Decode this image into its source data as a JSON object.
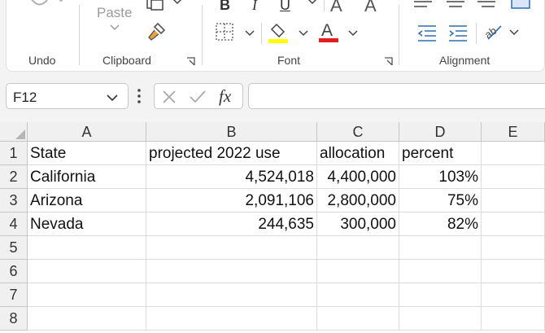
{
  "ribbon": {
    "groups": {
      "undo": "Undo",
      "clipboard": "Clipboard",
      "font": "Font",
      "alignment": "Alignment"
    },
    "paste_label": "Paste",
    "font_color": "#e02020",
    "highlight_color": "#ffff00"
  },
  "formula_bar": {
    "name_box": "F12",
    "formula": ""
  },
  "sheet": {
    "columns": [
      "A",
      "B",
      "C",
      "D",
      "E"
    ],
    "rows": [
      "1",
      "2",
      "3",
      "4",
      "5",
      "6",
      "7",
      "8"
    ],
    "cells": [
      [
        "State",
        "projected 2022 use",
        "allocation",
        "percent",
        ""
      ],
      [
        "California",
        "4,524,018",
        "4,400,000",
        "103%",
        ""
      ],
      [
        "Arizona",
        "2,091,106",
        "2,800,000",
        "75%",
        ""
      ],
      [
        "Nevada",
        "244,635",
        "300,000",
        "82%",
        ""
      ],
      [
        "",
        "",
        "",
        "",
        ""
      ],
      [
        "",
        "",
        "",
        "",
        ""
      ],
      [
        "",
        "",
        "",
        "",
        ""
      ],
      [
        "",
        "",
        "",
        "",
        ""
      ]
    ]
  }
}
